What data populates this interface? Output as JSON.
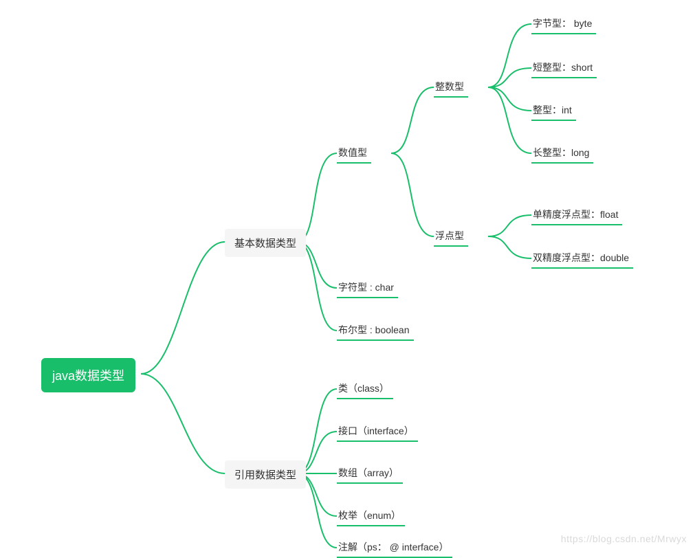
{
  "chart_data": {
    "type": "mindmap",
    "root": {
      "label": "java数据类型",
      "children": [
        {
          "label": "基本数据类型",
          "children": [
            {
              "label": "数值型",
              "children": [
                {
                  "label": "整数型",
                  "children": [
                    {
                      "label": "字节型： byte"
                    },
                    {
                      "label": "短整型：short"
                    },
                    {
                      "label": "整型：int"
                    },
                    {
                      "label": "长整型：long"
                    }
                  ]
                },
                {
                  "label": "浮点型",
                  "children": [
                    {
                      "label": "单精度浮点型：float"
                    },
                    {
                      "label": "双精度浮点型：double"
                    }
                  ]
                }
              ]
            },
            {
              "label": "字符型 : char"
            },
            {
              "label": "布尔型 : boolean"
            }
          ]
        },
        {
          "label": "引用数据类型",
          "children": [
            {
              "label": "类（class）"
            },
            {
              "label": "接口（interface）"
            },
            {
              "label": "数组（array）"
            },
            {
              "label": "枚举（enum）"
            },
            {
              "label": "注解（ps： @ interface）"
            }
          ]
        }
      ]
    }
  },
  "colors": {
    "accent": "#19be6b",
    "text": "#333333",
    "box_bg": "#f5f5f5"
  },
  "watermark": "https://blog.csdn.net/Mrwyx"
}
